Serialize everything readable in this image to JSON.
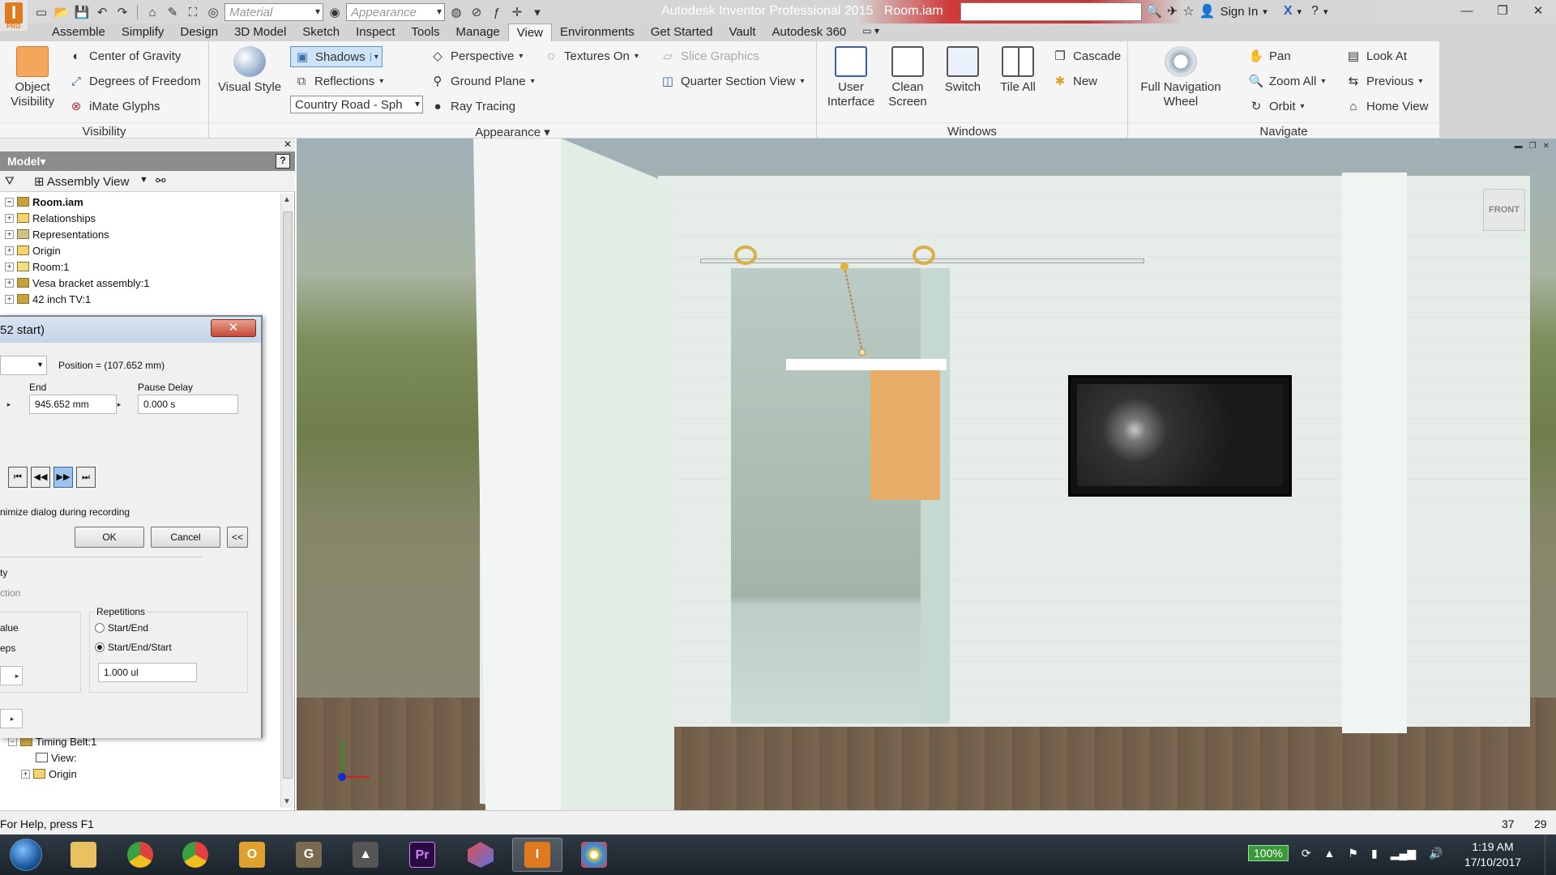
{
  "titlebar": {
    "app_name": "Autodesk Inventor Professional 2015",
    "document": "Room.iam",
    "material_placeholder": "Material",
    "appearance_placeholder": "Appearance",
    "sign_in": "Sign In"
  },
  "tabs": [
    "Assemble",
    "Simplify",
    "Design",
    "3D Model",
    "Sketch",
    "Inspect",
    "Tools",
    "Manage",
    "View",
    "Environments",
    "Get Started",
    "Vault",
    "Autodesk 360"
  ],
  "active_tab": "View",
  "ribbon": {
    "visibility": {
      "label": "Visibility",
      "object_visibility": "Object Visibility",
      "center_of_gravity": "Center of Gravity",
      "degrees_of_freedom": "Degrees of Freedom",
      "imate_glyphs": "iMate Glyphs"
    },
    "appearance": {
      "label": "Appearance",
      "visual_style": "Visual Style",
      "shadows": "Shadows",
      "reflections": "Reflections",
      "lighting_style": "Country Road - Sph",
      "perspective": "Perspective",
      "ground_plane": "Ground Plane",
      "ray_tracing": "Ray Tracing",
      "textures_on": "Textures On",
      "slice_graphics": "Slice Graphics",
      "quarter_section_view": "Quarter Section View"
    },
    "windows": {
      "label": "Windows",
      "user_interface": "User Interface",
      "clean_screen": "Clean Screen",
      "switch": "Switch",
      "tile_all": "Tile All",
      "cascade": "Cascade",
      "new": "New"
    },
    "navigate": {
      "label": "Navigate",
      "full_navigation_wheel": "Full Navigation Wheel",
      "pan": "Pan",
      "zoom_all": "Zoom All",
      "orbit": "Orbit",
      "look_at": "Look At",
      "previous": "Previous",
      "home_view": "Home View"
    }
  },
  "browser": {
    "model_label": "Model",
    "view_label": "Assembly View",
    "tree": [
      {
        "label": "Room.iam",
        "root": true
      },
      {
        "label": "Relationships"
      },
      {
        "label": "Representations"
      },
      {
        "label": "Origin"
      },
      {
        "label": "Room:1"
      },
      {
        "label": "Vesa bracket assembly:1"
      },
      {
        "label": "42 inch TV:1"
      }
    ],
    "tree_bottom": [
      {
        "label": "Timing Belt:1"
      },
      {
        "label": "View:"
      },
      {
        "label": "Origin"
      }
    ]
  },
  "dialog": {
    "title_fragment": "52 start)",
    "position_text": "Position = (107.652 mm)",
    "end_label": "End",
    "end_value": "945.652 mm",
    "pause_label": "Pause Delay",
    "pause_value": "0.000 s",
    "minimize_text": "nimize dialog during recording",
    "ok": "OK",
    "cancel": "Cancel",
    "collapse": "<<",
    "frag_ty": "ty",
    "frag_ction": "ction",
    "frag_alue": "alue",
    "frag_eps": "eps",
    "repetitions_label": "Repetitions",
    "rep_start_end": "Start/End",
    "rep_start_end_start": "Start/End/Start",
    "rep_selected": "Start/End/Start",
    "rep_value": "1.000 ul"
  },
  "viewport": {
    "viewcube_label": "FRONT"
  },
  "statusbar": {
    "help_text": "For Help, press F1",
    "num1": "37",
    "num2": "29"
  },
  "taskbar": {
    "apps": [
      "File Explorer",
      "Chrome",
      "Chrome",
      "Outlook",
      "GIMP",
      "Inkscape",
      "Premiere Pro",
      "App",
      "Autodesk Inventor",
      "Paint"
    ],
    "battery": "100%",
    "time": "1:19 AM",
    "date": "17/10/2017"
  },
  "colors": {
    "accent_orange": "#e07a1f",
    "title_red": "#c63535",
    "shadows_highlight": "#cde3f7"
  }
}
